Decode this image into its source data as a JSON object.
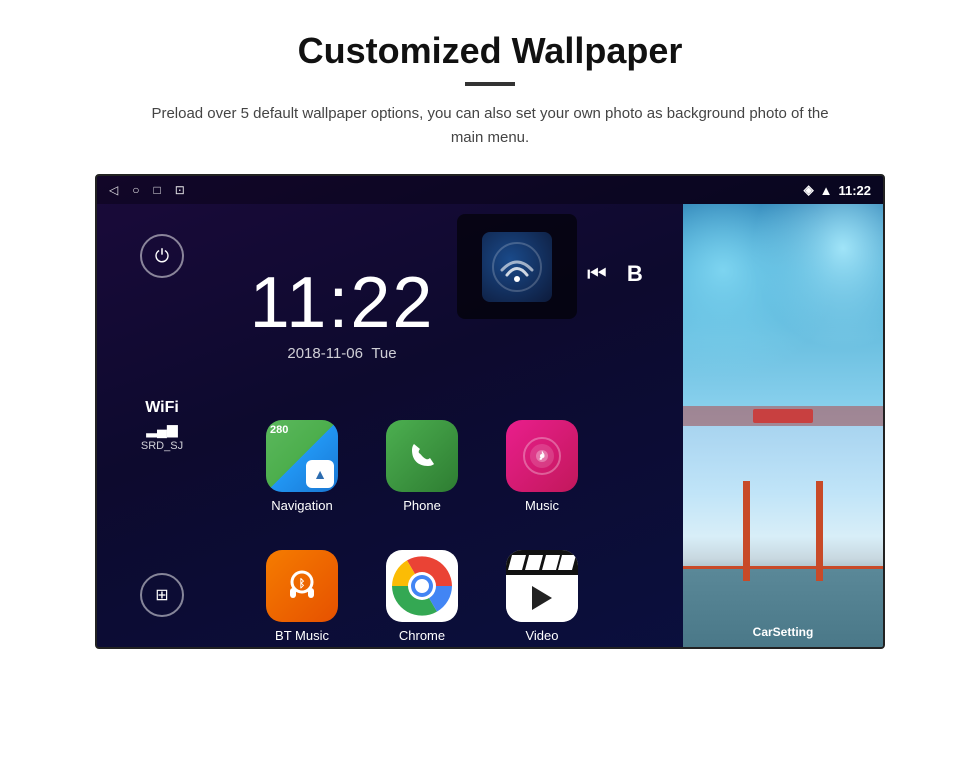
{
  "header": {
    "title": "Customized Wallpaper",
    "subtitle": "Preload over 5 default wallpaper options, you can also set your own photo as background photo of the main menu."
  },
  "device": {
    "status_bar": {
      "time": "11:22",
      "icons_left": [
        "back-arrow",
        "home-circle",
        "square-overview",
        "camera"
      ]
    },
    "clock": {
      "time": "11:22",
      "date": "2018-11-06",
      "day": "Tue"
    },
    "wifi": {
      "label": "WiFi",
      "ssid": "SRD_SJ"
    },
    "apps": [
      {
        "label": "Navigation",
        "icon": "navigation-icon"
      },
      {
        "label": "Phone",
        "icon": "phone-icon"
      },
      {
        "label": "Music",
        "icon": "music-icon"
      },
      {
        "label": "BT Music",
        "icon": "btmusic-icon"
      },
      {
        "label": "Chrome",
        "icon": "chrome-icon"
      },
      {
        "label": "Video",
        "icon": "video-icon"
      }
    ],
    "wallpapers": {
      "top_label": "",
      "bottom_label": "CarSetting"
    },
    "nav_road_label": "280",
    "car_setting_label": "CarSetting"
  },
  "colors": {
    "page_bg": "#ffffff",
    "device_bg_start": "#1a0a3a",
    "device_bg_end": "#0a1040",
    "accent_green": "#4caf50",
    "accent_pink": "#e91e8c",
    "accent_orange": "#f57c00",
    "chrome_blue": "#1565c0"
  }
}
